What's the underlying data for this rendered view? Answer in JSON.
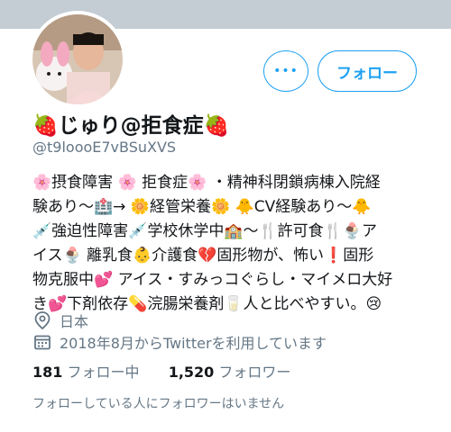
{
  "profile": {
    "name": "🍓じゅり@拒食症🍓",
    "handle": "@t9loooE7vBSuXVS",
    "bio_lines": [
      "🌸摂食障害 🌸 拒食症🌸 ・精神科閉鎖病棟入院経",
      "験あり〜🏥→ 🌼経管栄養🌼 🐥CV経験あり〜🐥",
      "💉強迫性障害💉学校休学中🏫〜🍴許可食🍴🍨ア",
      "イス🍨 離乳食👶介護食💔固形物が、怖い❗️固形",
      "物克服中💕 アイス・すみっコぐらし・マイメロ大好",
      "き💕下剤依存💊浣腸栄養剤🥛人と比べやすい。😢"
    ],
    "location": "日本",
    "joined": "2018年8月からTwitterを利用しています",
    "following_count": "181",
    "following_label": "フォロー中",
    "followers_count": "1,520",
    "followers_label": "フォロワー",
    "note": "フォローしている人にフォロワーはいません"
  },
  "buttons": {
    "more_label": "•••",
    "follow_label": "フォロー"
  },
  "colors": {
    "accent": "#1da1f2",
    "banner": "#c4ccd4",
    "secondary_text": "#657786"
  },
  "icons": {
    "more": "more-dots-icon",
    "location": "location-pin-icon",
    "calendar": "calendar-icon"
  }
}
